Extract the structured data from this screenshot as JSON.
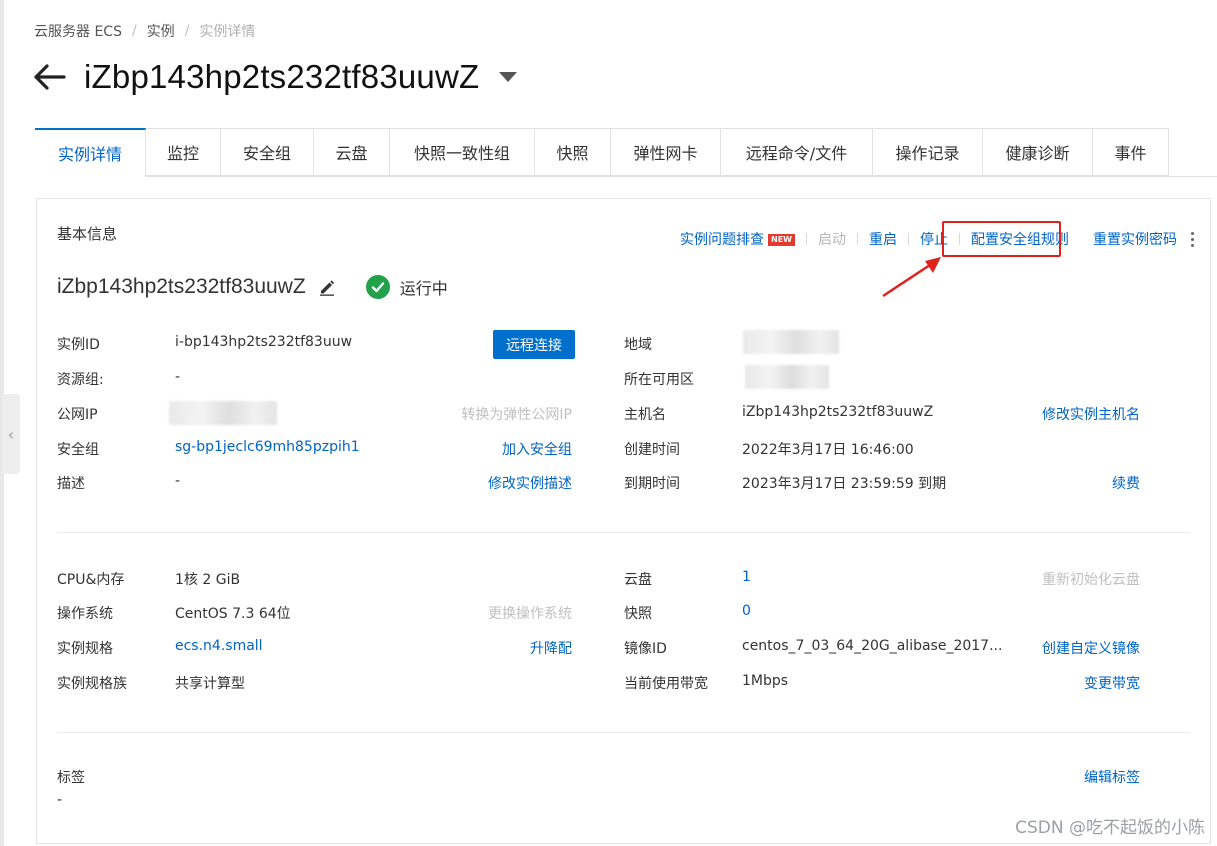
{
  "breadcrumb": {
    "item1": "云服务器 ECS",
    "item2": "实例",
    "current": "实例详情"
  },
  "header": {
    "title": "iZbp143hp2ts232tf83uuwZ"
  },
  "tabs": [
    {
      "label": "实例详情",
      "active": true
    },
    {
      "label": "监控"
    },
    {
      "label": "安全组"
    },
    {
      "label": "云盘"
    },
    {
      "label": "快照一致性组"
    },
    {
      "label": "快照"
    },
    {
      "label": "弹性网卡"
    },
    {
      "label": "远程命令/文件"
    },
    {
      "label": "操作记录"
    },
    {
      "label": "健康诊断"
    },
    {
      "label": "事件"
    }
  ],
  "basic_info": {
    "section_title": "基本信息",
    "actions": {
      "troubleshoot": "实例问题排查",
      "new_badge": "NEW",
      "start": "启动",
      "restart": "重启",
      "stop": "停止",
      "config_sg_rules": "配置安全组规则",
      "reset_password": "重置实例密码"
    },
    "instance_name": "iZbp143hp2ts232tf83uuwZ",
    "status": "运行中",
    "fields": {
      "instance_id_label": "实例ID",
      "instance_id_value": "i-bp143hp2ts232tf83uuw",
      "remote_connect": "远程连接",
      "resource_group_label": "资源组:",
      "resource_group_value": "-",
      "public_ip_label": "公网IP",
      "convert_eip": "转换为弹性公网IP",
      "security_group_label": "安全组",
      "security_group_value": "sg-bp1jeclc69mh85pzpih1",
      "join_sg": "加入安全组",
      "description_label": "描述",
      "description_value": "-",
      "modify_description": "修改实例描述",
      "region_label": "地域",
      "zone_label": "所在可用区",
      "hostname_label": "主机名",
      "hostname_value": "iZbp143hp2ts232tf83uuwZ",
      "modify_hostname": "修改实例主机名",
      "created_label": "创建时间",
      "created_value": "2022年3月17日 16:46:00",
      "expire_label": "到期时间",
      "expire_value": "2023年3月17日 23:59:59 到期",
      "renew": "续费"
    }
  },
  "config_info": {
    "cpu_mem_label": "CPU&内存",
    "cpu_mem_value": "1核 2 GiB",
    "os_label": "操作系统",
    "os_value": "CentOS 7.3 64位",
    "change_os": "更换操作系统",
    "spec_label": "实例规格",
    "spec_value": "ecs.n4.small",
    "upgrade": "升降配",
    "spec_family_label": "实例规格族",
    "spec_family_value": "共享计算型",
    "disk_label": "云盘",
    "disk_value": "1",
    "reinit_disk": "重新初始化云盘",
    "snapshot_label": "快照",
    "snapshot_value": "0",
    "image_label": "镜像ID",
    "image_value": "centos_7_03_64_20G_alibase_2017...",
    "create_image": "创建自定义镜像",
    "bandwidth_label": "当前使用带宽",
    "bandwidth_value": "1Mbps",
    "change_bandwidth": "变更带宽"
  },
  "tags_info": {
    "label": "标签",
    "value": "-",
    "edit": "编辑标签"
  },
  "watermark": "CSDN @吃不起饭的小陈",
  "colors": {
    "link": "#0064c8",
    "primary_button": "#0070cc",
    "status_green": "#23a04a",
    "annotation_red": "#e0221c"
  }
}
